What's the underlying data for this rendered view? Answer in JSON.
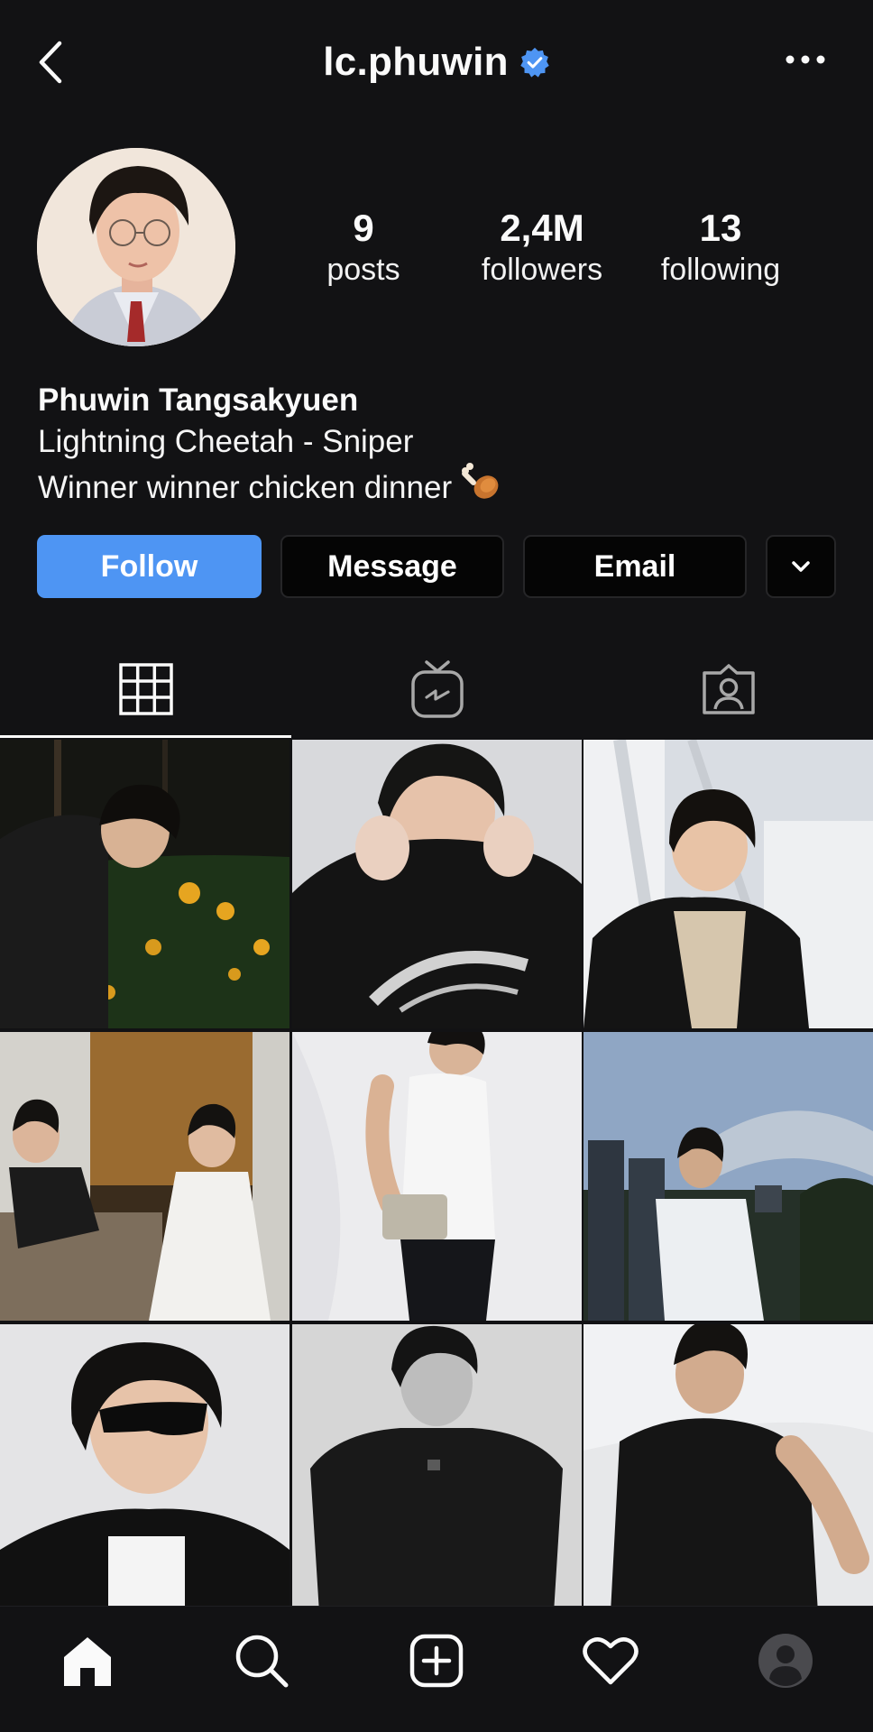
{
  "header": {
    "username": "lc.phuwin",
    "verified": true,
    "back_icon": "chevron-left-icon",
    "more_icon": "ellipsis-icon"
  },
  "profile": {
    "stats": [
      {
        "value": "9",
        "label": "posts"
      },
      {
        "value": "2,4M",
        "label": "followers"
      },
      {
        "value": "13",
        "label": "following"
      }
    ],
    "name": "Phuwin Tangsakyuen",
    "bio_lines": [
      "Lightning Cheetah - Sniper",
      "Winner winner chicken dinner"
    ],
    "bio_emoji": "poultry-leg-emoji"
  },
  "actions": {
    "follow": "Follow",
    "message": "Message",
    "email": "Email",
    "more_icon": "chevron-down-icon"
  },
  "tabs": [
    {
      "name": "grid",
      "icon": "grid-icon",
      "active": true
    },
    {
      "name": "igtv",
      "icon": "igtv-icon",
      "active": false
    },
    {
      "name": "tagged",
      "icon": "tagged-icon",
      "active": false
    }
  ],
  "posts": [
    {
      "photo": "boy-in-garden-night"
    },
    {
      "photo": "armani-shirt-covering-face"
    },
    {
      "photo": "smiling-denim-jacket"
    },
    {
      "photo": "two-men-in-lounge"
    },
    {
      "photo": "white-vest-with-bag"
    },
    {
      "photo": "city-skyline-dusk"
    },
    {
      "photo": "black-sunglasses-portrait"
    },
    {
      "photo": "bw-black-tee-portrait"
    },
    {
      "photo": "black-tank-top-sky"
    }
  ],
  "bottom_nav": [
    {
      "name": "home",
      "icon": "home-icon"
    },
    {
      "name": "search",
      "icon": "search-icon"
    },
    {
      "name": "create",
      "icon": "plus-square-icon"
    },
    {
      "name": "activity",
      "icon": "heart-icon"
    },
    {
      "name": "profile",
      "icon": "profile-avatar-icon"
    }
  ],
  "colors": {
    "background": "#121214",
    "accent": "#4e95f3",
    "text": "#fafafa"
  }
}
